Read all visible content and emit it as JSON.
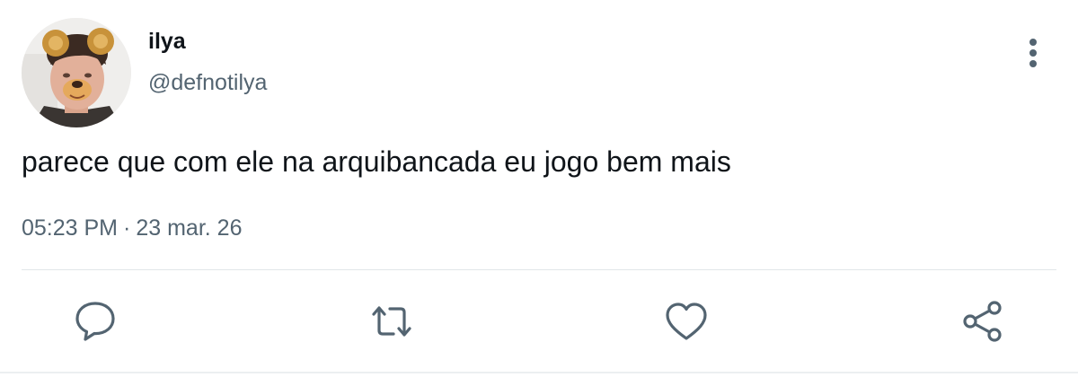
{
  "tweet": {
    "display_name": "ilya",
    "handle": "@defnotilya",
    "text": "parece que com ele na arquibancada eu jogo bem mais",
    "time": "05:23 PM",
    "separator": "·",
    "date": "23 mar. 26"
  },
  "icons": {
    "more": "more-vertical-icon",
    "reply": "reply-icon",
    "retweet": "retweet-icon",
    "like": "heart-icon",
    "share": "share-icon"
  },
  "colors": {
    "text": "#0f1419",
    "secondary": "#536471",
    "icon": "#536471",
    "divider": "#e2e6e9"
  }
}
